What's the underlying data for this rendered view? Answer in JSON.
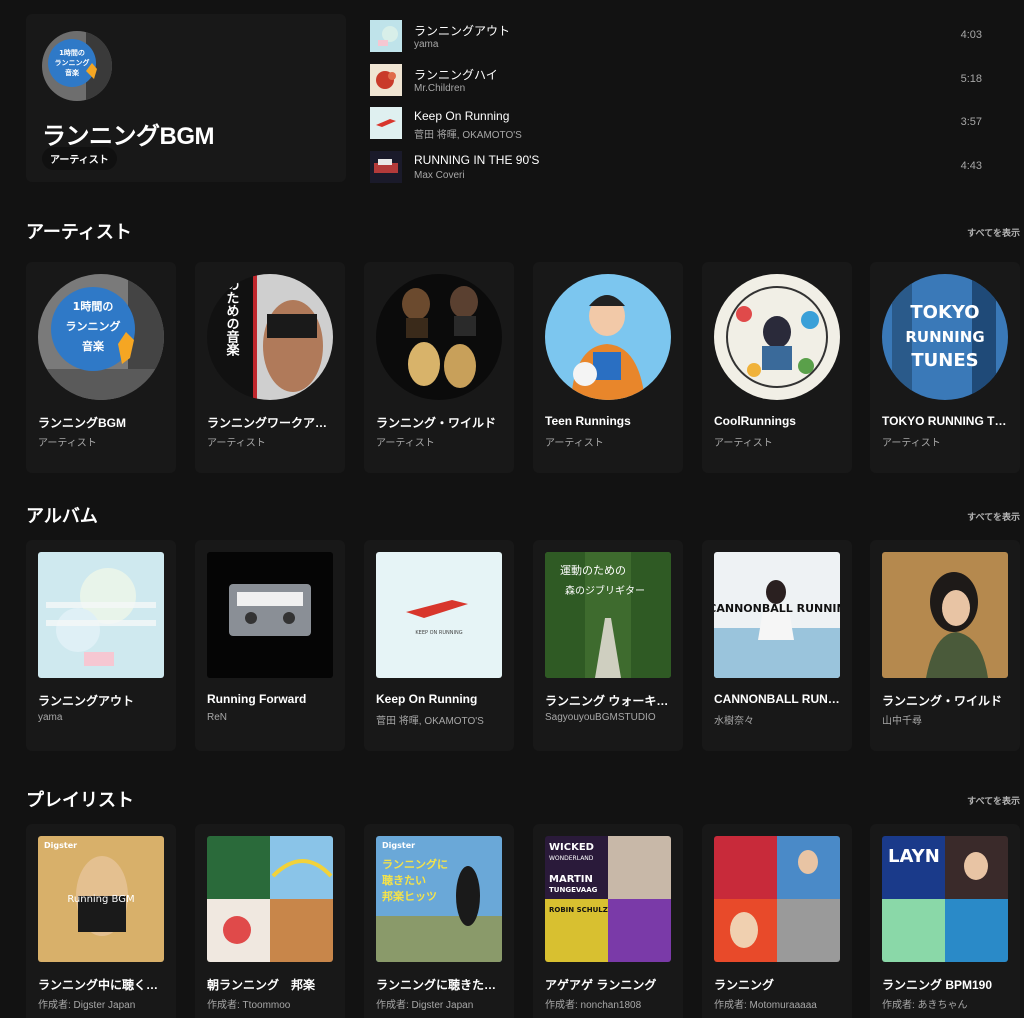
{
  "top_result": {
    "title": "ランニングBGM",
    "badge": "アーティスト",
    "avatar_lines": [
      "1時間の",
      "ランニング",
      "音楽"
    ]
  },
  "songs": [
    {
      "title": "ランニングアウト",
      "artist": "yama",
      "duration": "4:03"
    },
    {
      "title": "ランニングハイ",
      "artist": "Mr.Children",
      "duration": "5:18"
    },
    {
      "title": "Keep On Running",
      "artist": "菅田 将暉, OKAMOTO'S",
      "duration": "3:57"
    },
    {
      "title": "RUNNING IN THE 90'S",
      "artist": "Max Coveri",
      "duration": "4:43"
    }
  ],
  "artists": {
    "title": "アーティスト",
    "more": "すべてを表示",
    "items": [
      {
        "title": "ランニングBGM",
        "sub": "アーティスト",
        "art": [
          "1時間の",
          "ランニング",
          "音楽"
        ]
      },
      {
        "title": "ランニングワークア…",
        "sub": "アーティスト",
        "art": [
          "運動のための音楽"
        ]
      },
      {
        "title": "ランニング・ワイルド",
        "sub": "アーティスト",
        "art": []
      },
      {
        "title": "Teen Runnings",
        "sub": "アーティスト",
        "art": []
      },
      {
        "title": "CoolRunnings",
        "sub": "アーティスト",
        "art": []
      },
      {
        "title": "TOKYO RUNNING T…",
        "sub": "アーティスト",
        "art": [
          "TOKYO",
          "RUNNING",
          "TUNES"
        ]
      }
    ]
  },
  "albums": {
    "title": "アルバム",
    "more": "すべてを表示",
    "items": [
      {
        "title": "ランニングアウト",
        "sub": "yama",
        "art": []
      },
      {
        "title": "Running Forward",
        "sub": "ReN",
        "art": []
      },
      {
        "title": "Keep On Running",
        "sub": "菅田 将暉, OKAMOTO'S",
        "art": [
          "KEEP ON RUNNING"
        ]
      },
      {
        "title": "ランニング ウォーキ…",
        "sub": "SagyouyouBGMSTUDIO",
        "art": [
          "運動のための",
          "森のジブリギター"
        ]
      },
      {
        "title": "CANNONBALL RUN…",
        "sub": "水樹奈々",
        "art": [
          "CANNONBALL RUNNIN"
        ]
      },
      {
        "title": "ランニング・ワイルド",
        "sub": "山中千尋",
        "art": []
      }
    ]
  },
  "playlists": {
    "title": "プレイリスト",
    "more": "すべてを表示",
    "items": [
      {
        "title": "ランニング中に聴く…",
        "sub": "作成者: Digster Japan",
        "art": [
          "Digster",
          "Running BGM"
        ]
      },
      {
        "title": "朝ランニング　邦楽",
        "sub": "作成者: Ttoommoo",
        "art": []
      },
      {
        "title": "ランニングに聴きた…",
        "sub": "作成者: Digster Japan",
        "art": [
          "Digster",
          "ランニングに",
          "聴きたい",
          "邦楽ヒッツ"
        ]
      },
      {
        "title": "アゲアゲ ランニング",
        "sub": "作成者: nonchan1808",
        "art": [
          "WICKED",
          "WONDERLAND",
          "MARTIN",
          "TUNGEVAAG",
          "ROBIN SCHULZ"
        ]
      },
      {
        "title": "ランニング",
        "sub": "作成者: Motomuraaaaa",
        "art": []
      },
      {
        "title": "ランニング BPM190",
        "sub": "作成者: あきちゃん",
        "art": [
          "LAYN"
        ]
      }
    ]
  },
  "colors": {
    "background": "#121212",
    "card": "#181818",
    "subtext": "#a7a7a7"
  }
}
